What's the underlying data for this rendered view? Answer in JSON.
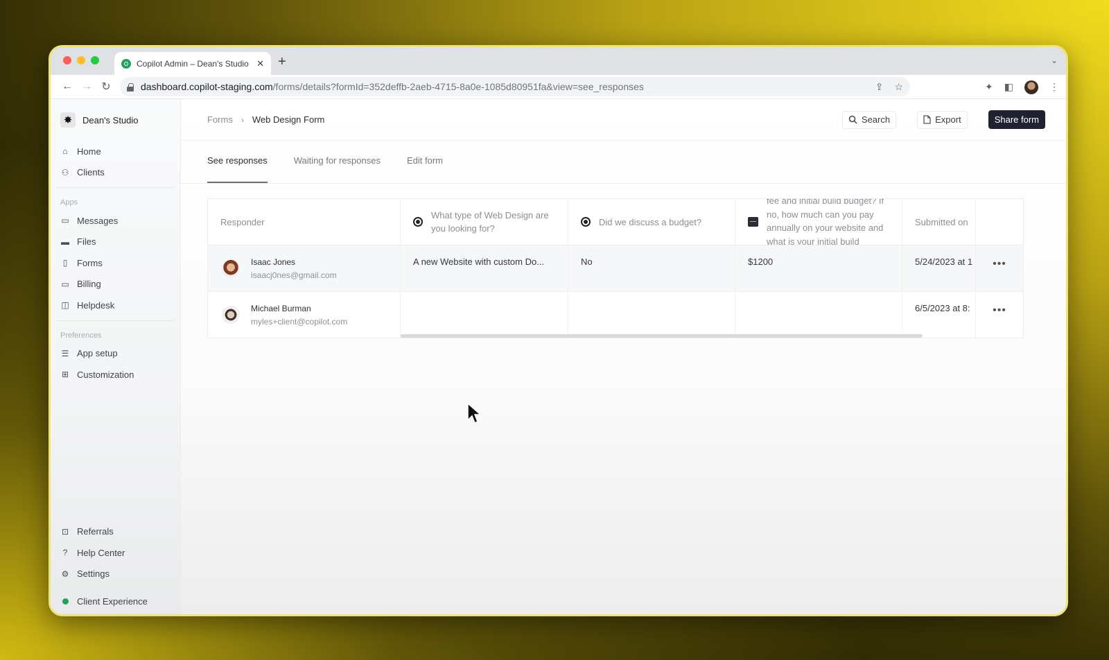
{
  "browser": {
    "tab_title": "Copilot Admin – Dean's Studio",
    "tab_close": "✕",
    "new_tab": "+",
    "url_host": "dashboard.copilot-staging.com",
    "url_path": "/forms/details?formId=352deffb-2aeb-4715-8a0e-1085d80951fa&view=see_responses",
    "nav": {
      "back": "←",
      "forward": "→",
      "reload": "↻"
    },
    "icons": {
      "share": "⇪",
      "bookmark": "☆",
      "extensions": "✦",
      "side_panel": "◧",
      "menu": "⋮",
      "tab_search": "⌄"
    }
  },
  "sidebar": {
    "workspace_name": "Dean's Studio",
    "workspace_logo": "✸",
    "primary": [
      {
        "label": "Home",
        "icon": "⌂"
      },
      {
        "label": "Clients",
        "icon": "⚇"
      }
    ],
    "apps_heading": "Apps",
    "apps": [
      {
        "label": "Messages",
        "icon": "▭"
      },
      {
        "label": "Files",
        "icon": "▬"
      },
      {
        "label": "Forms",
        "icon": "▯"
      },
      {
        "label": "Billing",
        "icon": "▭"
      },
      {
        "label": "Helpdesk",
        "icon": "◫"
      }
    ],
    "preferences_heading": "Preferences",
    "preferences": [
      {
        "label": "App setup",
        "icon": "☰"
      },
      {
        "label": "Customization",
        "icon": "⊞"
      }
    ],
    "bottom": [
      {
        "label": "Referrals",
        "icon": "⊡"
      },
      {
        "label": "Help Center",
        "icon": "?"
      },
      {
        "label": "Settings",
        "icon": "⚙"
      }
    ],
    "client_experience": "Client Experience"
  },
  "header": {
    "breadcrumb_parent": "Forms",
    "breadcrumb_separator": "›",
    "breadcrumb_current": "Web Design Form",
    "search_label": "Search",
    "export_label": "Export",
    "share_label": "Share form"
  },
  "tabs": [
    {
      "label": "See responses",
      "active": true
    },
    {
      "label": "Waiting for responses",
      "active": false
    },
    {
      "label": "Edit form",
      "active": false
    }
  ],
  "table": {
    "columns": {
      "responder": "Responder",
      "q1": "What type of Web Design are you looking for?",
      "q2": "Did we discuss a budget?",
      "q3": "fee and initial build budget? If no, how much can you pay annually on your website and what is your initial build",
      "submitted": "Submitted on"
    },
    "rows": [
      {
        "name": "Isaac Jones",
        "email": "isaacj0nes@gmail.com",
        "q1": "A new Website with custom Do...",
        "q2": "No",
        "q3": "$1200",
        "submitted": "5/24/2023 at 1",
        "actions": "•••"
      },
      {
        "name": "Michael Burman",
        "email": "myles+client@copilot.com",
        "q1": "",
        "q2": "",
        "q3": "",
        "submitted": "6/5/2023 at 8:",
        "actions": "•••"
      }
    ]
  }
}
